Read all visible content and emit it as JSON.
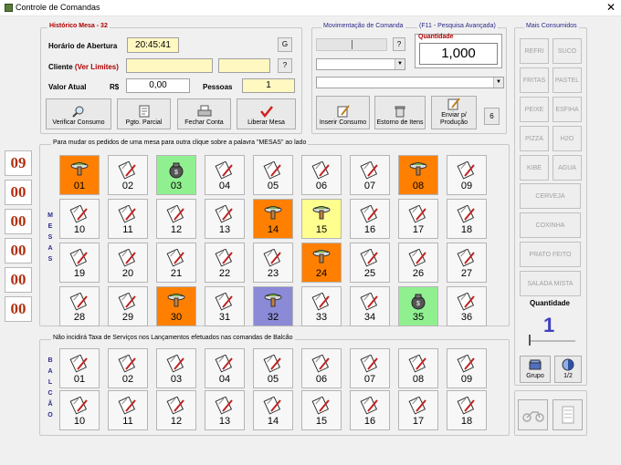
{
  "window": {
    "title": "Controle de Comandas",
    "close": "✕"
  },
  "historico": {
    "legend_prefix": "Histórico Mesa",
    "legend_sep": "-",
    "mesa": "32",
    "abertura_label": "Horário de Abertura",
    "abertura_value": "20:45:41",
    "g_button": "G",
    "cliente_label": "Cliente",
    "ver_limites": "(Ver Limites)",
    "help_button": "?",
    "valor_label": "Valor Atual",
    "currency": "R$",
    "valor_value": "0,00",
    "pessoas_label": "Pessoas",
    "pessoas_value": "1"
  },
  "actions": {
    "verificar": "Verificar Consumo",
    "pgto": "Pgto. Parcial",
    "fechar": "Fechar Conta",
    "liberar": "Liberar Mesa"
  },
  "movimentacao": {
    "legend": "Movimentação de Comanda",
    "help": "?",
    "f11": "(F11 - Pesquisa Avançada)",
    "quantidade_label": "Quantidade",
    "quantidade_value": "1,000",
    "inserir": "Inserir Consumo",
    "estorno": "Estorno de Itens",
    "enviar": "Enviar p/ Produção",
    "six": "6"
  },
  "counters": [
    "09",
    "00",
    "00",
    "00",
    "00",
    "00"
  ],
  "mesas": {
    "legend": "Para mudar os pedidos de uma mesa para outra clique sobre a palavra \"MESAS\" ao lado",
    "vertical": "MESAS",
    "tables": [
      {
        "n": "01",
        "bg": "#ff8000",
        "icon": "dish"
      },
      {
        "n": "02",
        "bg": "#f7f7f7",
        "icon": "pad"
      },
      {
        "n": "03",
        "bg": "#90f090",
        "icon": "bag"
      },
      {
        "n": "04",
        "bg": "#f7f7f7",
        "icon": "pad"
      },
      {
        "n": "05",
        "bg": "#f7f7f7",
        "icon": "pad"
      },
      {
        "n": "06",
        "bg": "#f7f7f7",
        "icon": "pad"
      },
      {
        "n": "07",
        "bg": "#f7f7f7",
        "icon": "pad"
      },
      {
        "n": "08",
        "bg": "#ff8000",
        "icon": "dish"
      },
      {
        "n": "09",
        "bg": "#f7f7f7",
        "icon": "pad"
      },
      {
        "n": "10",
        "bg": "#f7f7f7",
        "icon": "pad"
      },
      {
        "n": "11",
        "bg": "#f7f7f7",
        "icon": "pad"
      },
      {
        "n": "12",
        "bg": "#f7f7f7",
        "icon": "pad"
      },
      {
        "n": "13",
        "bg": "#f7f7f7",
        "icon": "pad"
      },
      {
        "n": "14",
        "bg": "#ff8000",
        "icon": "dish"
      },
      {
        "n": "15",
        "bg": "#ffff90",
        "icon": "dish"
      },
      {
        "n": "16",
        "bg": "#f7f7f7",
        "icon": "pad"
      },
      {
        "n": "17",
        "bg": "#f7f7f7",
        "icon": "pad"
      },
      {
        "n": "18",
        "bg": "#f7f7f7",
        "icon": "pad"
      },
      {
        "n": "19",
        "bg": "#f7f7f7",
        "icon": "pad"
      },
      {
        "n": "20",
        "bg": "#f7f7f7",
        "icon": "pad"
      },
      {
        "n": "21",
        "bg": "#f7f7f7",
        "icon": "pad"
      },
      {
        "n": "22",
        "bg": "#f7f7f7",
        "icon": "pad"
      },
      {
        "n": "23",
        "bg": "#f7f7f7",
        "icon": "pad"
      },
      {
        "n": "24",
        "bg": "#ff8000",
        "icon": "dish"
      },
      {
        "n": "25",
        "bg": "#f7f7f7",
        "icon": "pad"
      },
      {
        "n": "26",
        "bg": "#f7f7f7",
        "icon": "pad"
      },
      {
        "n": "27",
        "bg": "#f7f7f7",
        "icon": "pad"
      },
      {
        "n": "28",
        "bg": "#f7f7f7",
        "icon": "pad"
      },
      {
        "n": "29",
        "bg": "#f7f7f7",
        "icon": "pad"
      },
      {
        "n": "30",
        "bg": "#ff8000",
        "icon": "dish"
      },
      {
        "n": "31",
        "bg": "#f7f7f7",
        "icon": "pad"
      },
      {
        "n": "32",
        "bg": "#8a8ad6",
        "icon": "dish"
      },
      {
        "n": "33",
        "bg": "#f7f7f7",
        "icon": "pad"
      },
      {
        "n": "34",
        "bg": "#f7f7f7",
        "icon": "pad"
      },
      {
        "n": "35",
        "bg": "#90f090",
        "icon": "bag"
      },
      {
        "n": "36",
        "bg": "#f7f7f7",
        "icon": "pad"
      }
    ]
  },
  "balcao": {
    "legend": "Não incidirá Taxa de Serviços nos Lançamentos efetuados nas comandas de Balcão",
    "vertical": "BALCÃO",
    "tables": [
      "01",
      "02",
      "03",
      "04",
      "05",
      "06",
      "07",
      "08",
      "09",
      "10",
      "11",
      "12",
      "13",
      "14",
      "15",
      "16",
      "17",
      "18"
    ]
  },
  "mais_consumidos": {
    "legend": "Mais Consumidos",
    "pairs": [
      [
        "REFRI",
        "SUCO"
      ],
      [
        "FRITAS",
        "PASTEL"
      ],
      [
        "PEIXE",
        "ESFIHA"
      ],
      [
        "PIZZA",
        "H2O"
      ],
      [
        "KIBE",
        "AGUA"
      ]
    ],
    "singles": [
      "CERVEJA",
      "COXINHA",
      "PRATO FEITO",
      "SALADA MISTA"
    ],
    "quantidade_label": "Quantidade",
    "quantidade_value": "1",
    "grupo": "Grupo",
    "half": "1/2"
  }
}
